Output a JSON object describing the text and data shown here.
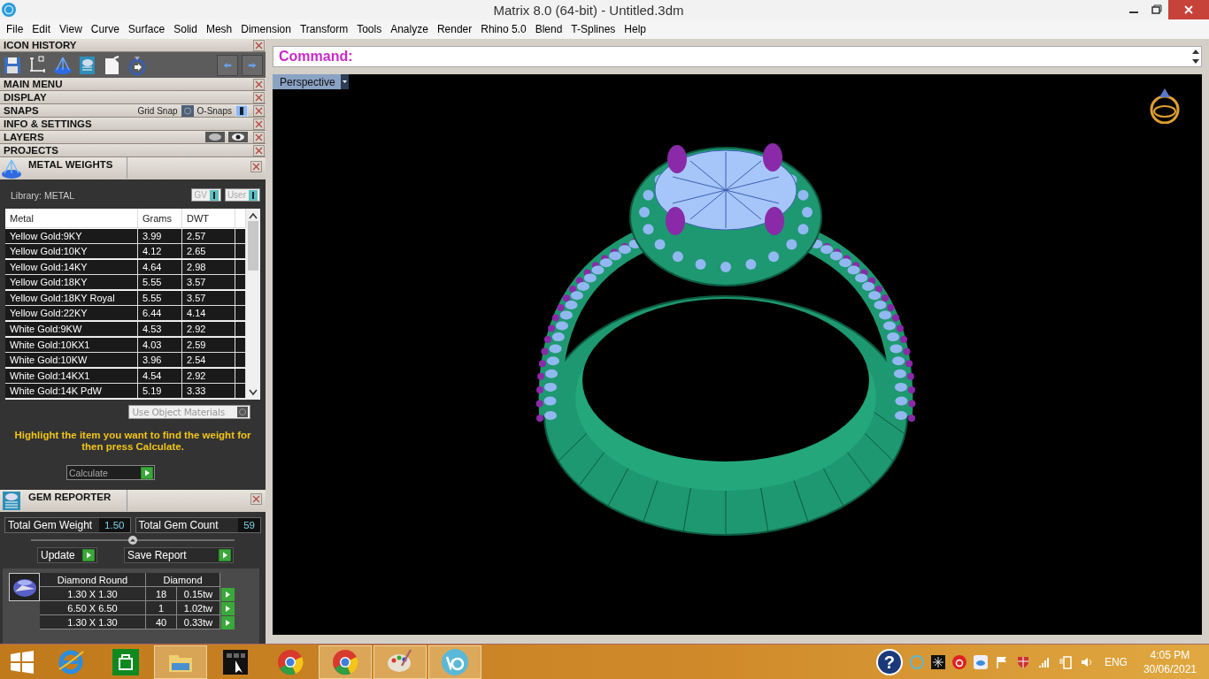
{
  "window": {
    "title": "Matrix 8.0 (64-bit) - Untitled.3dm"
  },
  "menu": [
    "File",
    "Edit",
    "View",
    "Curve",
    "Surface",
    "Solid",
    "Mesh",
    "Dimension",
    "Transform",
    "Tools",
    "Analyze",
    "Render",
    "Rhino 5.0",
    "Blend",
    "T-Splines",
    "Help"
  ],
  "icon_history": {
    "title": "ICON HISTORY",
    "tools": [
      {
        "kind": "save"
      },
      {
        "kind": "dimension"
      },
      {
        "kind": "scale"
      },
      {
        "kind": "report"
      },
      {
        "kind": "document"
      },
      {
        "kind": "ring"
      }
    ]
  },
  "sections": [
    {
      "title": "MAIN MENU",
      "kind": "plain"
    },
    {
      "title": "DISPLAY",
      "kind": "plain"
    },
    {
      "title": "SNAPS",
      "kind": "snaps",
      "toggles": [
        {
          "label": "Grid Snap",
          "on": false
        },
        {
          "label": "O-Snaps",
          "on": true
        }
      ]
    },
    {
      "title": "INFO & SETTINGS",
      "kind": "plain"
    },
    {
      "title": "LAYERS",
      "kind": "layers"
    },
    {
      "title": "PROJECTS",
      "kind": "plain"
    }
  ],
  "metal_weights": {
    "title": "METAL WEIGHTS",
    "library": "Library: METAL",
    "toggles": [
      {
        "label": "GV",
        "on": true
      },
      {
        "label": "User",
        "on": true
      }
    ],
    "columns": [
      "Metal",
      "Grams",
      "DWT"
    ],
    "rows": [
      [
        "Yellow Gold:9KY",
        "3.99",
        "2.57"
      ],
      [
        "Yellow Gold:10KY",
        "4.12",
        "2.65"
      ],
      [
        "Yellow Gold:14KY",
        "4.64",
        "2.98"
      ],
      [
        "Yellow Gold:18KY",
        "5.55",
        "3.57"
      ],
      [
        "Yellow Gold:18KY Royal",
        "5.55",
        "3.57"
      ],
      [
        "Yellow Gold:22KY",
        "6.44",
        "4.14"
      ],
      [
        "White Gold:9KW",
        "4.53",
        "2.92"
      ],
      [
        "White Gold:10KX1",
        "4.03",
        "2.59"
      ],
      [
        "White Gold:10KW",
        "3.96",
        "2.54"
      ],
      [
        "White Gold:14KX1",
        "4.54",
        "2.92"
      ],
      [
        "White Gold:14K PdW",
        "5.19",
        "3.33"
      ]
    ],
    "use_object_materials": {
      "label": "Use Object Materials",
      "on": false
    },
    "hint": "Highlight the item you want to find the weight for then press Calculate.",
    "calculate": "Calculate"
  },
  "gem_reporter": {
    "title": "GEM REPORTER",
    "weight_label": "Total Gem Weight",
    "weight": "1.50",
    "count_label": "Total Gem Count",
    "count": "59",
    "update": "Update",
    "save_report": "Save Report",
    "columns": [
      "Diamond Round",
      "Diamond"
    ],
    "rows": [
      [
        "1.30 X 1.30",
        "18",
        "0.15tw"
      ],
      [
        "6.50 X 6.50",
        "1",
        "1.02tw"
      ],
      [
        "1.30 X 1.30",
        "40",
        "0.33tw"
      ]
    ]
  },
  "command": {
    "label": "Command:"
  },
  "viewport": {
    "name": "Perspective"
  },
  "taskbar": {
    "apps": [
      {
        "kind": "ie",
        "running": false
      },
      {
        "kind": "store",
        "running": false
      },
      {
        "kind": "folder",
        "running": true
      },
      {
        "kind": "keypad",
        "running": false
      },
      {
        "kind": "chrome",
        "running": false
      },
      {
        "kind": "chrome",
        "running": true
      },
      {
        "kind": "paint",
        "running": true
      },
      {
        "kind": "matrix",
        "running": true
      }
    ],
    "help": "?",
    "language": "ENG",
    "time": "4:05 PM",
    "date": "30/06/2021"
  }
}
